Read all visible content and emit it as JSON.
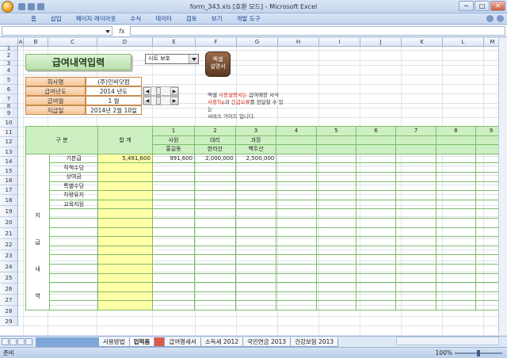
{
  "window": {
    "title": "form_343.xls [호환 모드] - Microsoft Excel",
    "controls": {
      "minimize": "─",
      "maximize": "□",
      "close": "✕"
    }
  },
  "ribbon": {
    "tabs": [
      "홈",
      "삽입",
      "페이지 레이아웃",
      "수식",
      "데이터",
      "검토",
      "보기",
      "개발 도구"
    ]
  },
  "formula_bar": {
    "fx": "fx"
  },
  "columns": [
    "A",
    "B",
    "C",
    "D",
    "E",
    "F",
    "G",
    "H",
    "I",
    "J",
    "K",
    "L",
    "M"
  ],
  "rows": [
    "1",
    "2",
    "3",
    "4",
    "5",
    "6",
    "7",
    "8",
    "9",
    "10",
    "11",
    "12",
    "13",
    "14",
    "15",
    "16",
    "17",
    "18",
    "19",
    "20",
    "21",
    "22",
    "23",
    "24",
    "25",
    "26",
    "27",
    "28",
    "29"
  ],
  "banner": {
    "title": "급여내역입력"
  },
  "sheet_protect": {
    "label": "시트 보호"
  },
  "manual_icon": {
    "line1": "엑셀",
    "line2": "설명서"
  },
  "info": [
    {
      "label": "회사명",
      "value": "(주)인비닷컴"
    },
    {
      "label": "급여년도",
      "value": "2014 년도"
    },
    {
      "label": "급여월",
      "value": "1 월"
    },
    {
      "label": "지급일",
      "value": "2014년 2월 10일"
    }
  ],
  "notice": {
    "line1_a": "엑셀 ",
    "line1_b": "사용설명서는",
    "line1_c": " 급여매장 서식",
    "line2_a": "사용Tip",
    "line2_b": "과 ",
    "line2_c": "긴급오류",
    "line2_d": "를 전달할 수 있는",
    "line3": "서비스 가이드 입니다."
  },
  "table": {
    "col_gubun": "구  분",
    "col_total": "합  계",
    "col_numbers": [
      "1",
      "2",
      "3",
      "4",
      "5",
      "6",
      "7",
      "8",
      "9"
    ],
    "positions": [
      "사원",
      "대리",
      "과장"
    ],
    "names": [
      "홍길동",
      "한라산",
      "백두산"
    ],
    "side_label": [
      "지",
      "급",
      "내",
      "역"
    ],
    "items": [
      "기본급",
      "직책수당",
      "상여금",
      "특별수당",
      "차량유지",
      "교육지원"
    ],
    "basic_pay": {
      "total": "5,491,600",
      "values": [
        "991,600",
        "2,000,000",
        "2,500,000"
      ]
    }
  },
  "sheet_tabs": [
    "사용방법",
    "입력폼",
    "급여명세서",
    "소득세 2012",
    "국민연금 2013",
    "건강보험 2013"
  ],
  "status": {
    "ready": "준비",
    "zoom": "100%"
  }
}
